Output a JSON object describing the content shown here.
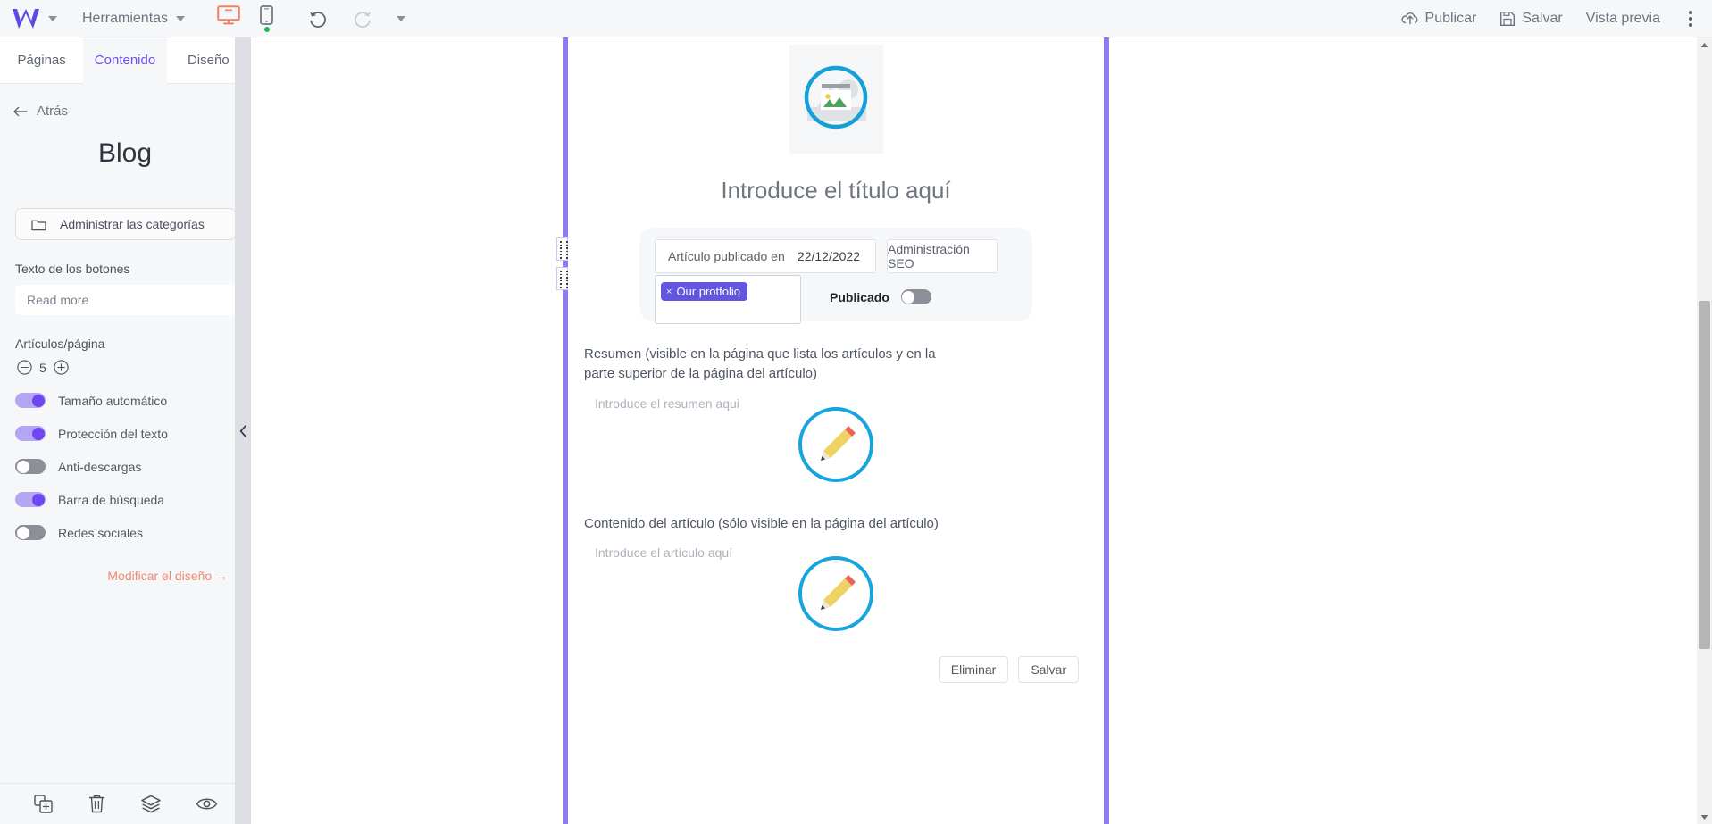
{
  "topbar": {
    "logo": "w-logo-icon",
    "menu_label": "Herramientas",
    "devices": [
      {
        "name": "desktop-view",
        "label": "Escritorio",
        "active": true
      },
      {
        "name": "mobile-view",
        "label": "Móvil",
        "active": false
      }
    ],
    "undo_label": "Deshacer",
    "redo_label": "Rehacer",
    "actions": [
      {
        "name": "publish",
        "label": "Publicar",
        "icon": "cloud-upload-icon"
      },
      {
        "name": "save",
        "label": "Salvar",
        "icon": "floppy-disk-icon"
      },
      {
        "name": "preview",
        "label": "Vista previa",
        "icon": ""
      }
    ],
    "more_label": "Más opciones"
  },
  "sidebar": {
    "tabs": [
      {
        "label": "Páginas",
        "active": false
      },
      {
        "label": "Contenido",
        "active": true
      },
      {
        "label": "Diseño",
        "active": false
      }
    ],
    "back_label": "Atrás",
    "section_title": "Blog",
    "manage_categories_label": "Administrar las categorías",
    "button_text": {
      "label": "Texto de los botones",
      "value": "Read more",
      "placeholder": "Read more"
    },
    "articles_per_page": {
      "label": "Artículos/página",
      "value": "5",
      "decrement": "minus-circle-icon",
      "increment": "plus-circle-icon"
    },
    "toggles": [
      {
        "label": "Tamaño automático",
        "on": true
      },
      {
        "label": "Protección del texto",
        "on": true
      },
      {
        "label": "Anti-descargas",
        "on": false
      },
      {
        "label": "Barra de búsqueda",
        "on": true
      },
      {
        "label": "Redes sociales",
        "on": false
      }
    ],
    "design_link": "Modificar el diseño  →",
    "bottom_icons": [
      {
        "name": "duplicate-icon",
        "label": "Duplicar"
      },
      {
        "name": "trash-icon",
        "label": "Eliminar"
      },
      {
        "name": "layers-icon",
        "label": "Capas"
      },
      {
        "name": "eye-icon",
        "label": "Visibilidad"
      }
    ],
    "collapse_icon": "chevron-left-icon"
  },
  "canvas": {
    "image_placeholder": "image-placeholder-icon",
    "article_title": "Introduce el título aquí",
    "meta": {
      "published_on_label": "Artículo publicado en",
      "published_date": "22/12/2022",
      "seo_label": "Administración SEO",
      "tags": [
        {
          "label": "Our protfolio",
          "remove": "×"
        }
      ],
      "published_toggle_label": "Publicado",
      "published_toggle_on": false
    },
    "summary": {
      "label": "Resumen (visible en la página que lista los artículos y en la parte superior de la página del artículo)",
      "placeholder": "Introduce el resumen aqui",
      "edit_icon": "pencil-icon"
    },
    "content": {
      "label": "Contenido del artículo (sólo visible en la página del artículo)",
      "placeholder": "Introduce el artículo aquí",
      "edit_icon": "pencil-icon"
    },
    "footer_buttons": [
      {
        "name": "delete-button",
        "label": "Eliminar"
      },
      {
        "name": "save-button",
        "label": "Salvar"
      }
    ]
  },
  "colors": {
    "accent_purple": "#6c4ef0",
    "frame_purple": "#8d7bf0",
    "link_orange": "#f08a72",
    "tag_purple": "#6355e0",
    "device_active": "#f28162",
    "placeholder_blue": "#14a0d6"
  }
}
